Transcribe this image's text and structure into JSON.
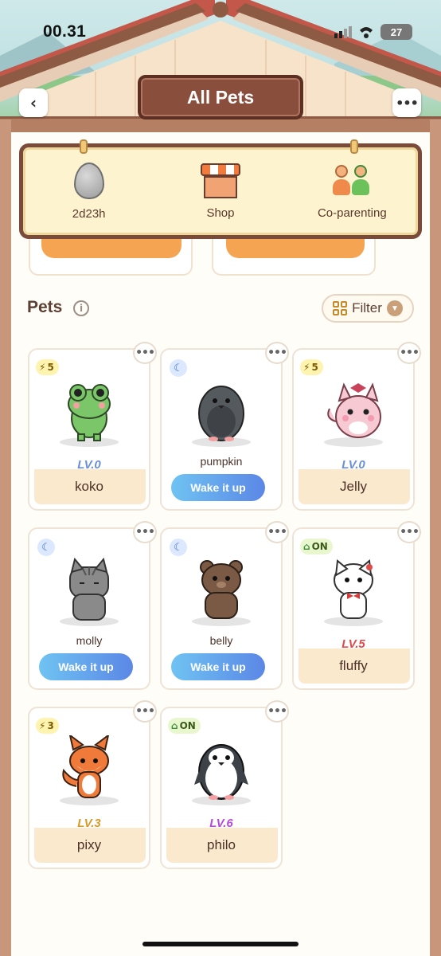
{
  "status_bar": {
    "time": "00.31",
    "battery": "27"
  },
  "header": {
    "title": "All Pets",
    "back_icon": "chevron-left-icon",
    "more_icon": "more-dots-icon"
  },
  "shortcuts": [
    {
      "id": "egg",
      "label": "2d23h",
      "icon": "egg-icon"
    },
    {
      "id": "shop",
      "label": "Shop",
      "icon": "shop-icon"
    },
    {
      "id": "coparenting",
      "label": "Co-parenting",
      "icon": "co-parenting-icon"
    }
  ],
  "pets_section": {
    "title": "Pets",
    "filter_label": "Filter"
  },
  "pets": [
    {
      "name": "koko",
      "level": "LV.0",
      "badge": "5",
      "status": "energy",
      "color": "#7cc66a"
    },
    {
      "name": "pumpkin",
      "status": "sleeping",
      "action": "Wake it up",
      "color": "#555a5f"
    },
    {
      "name": "Jelly",
      "level": "LV.0",
      "badge": "5",
      "status": "energy",
      "color": "#f7c9d3"
    },
    {
      "name": "molly",
      "status": "sleeping",
      "action": "Wake it up",
      "color": "#8a8a8a"
    },
    {
      "name": "belly",
      "status": "sleeping",
      "action": "Wake it up",
      "color": "#7a5a44"
    },
    {
      "name": "fluffy",
      "level": "LV.5",
      "badge": "ON",
      "status": "home",
      "color": "#ffffff"
    },
    {
      "name": "pixy",
      "level": "LV.3",
      "badge": "3",
      "status": "energy",
      "color": "#ef7a3a"
    },
    {
      "name": "philo",
      "level": "LV.6",
      "badge": "ON",
      "status": "home",
      "color": "#3d4248"
    }
  ],
  "colors": {
    "wood": "#7a4a3a",
    "plaque": "#8a4f3c",
    "wake_gradient_start": "#6fc3f2",
    "wake_gradient_end": "#5b87e6",
    "lv0": "#6c8fd6",
    "lv5": "#e04a4a",
    "lv3": "#d89a2a",
    "lv6": "#b64ad8"
  }
}
